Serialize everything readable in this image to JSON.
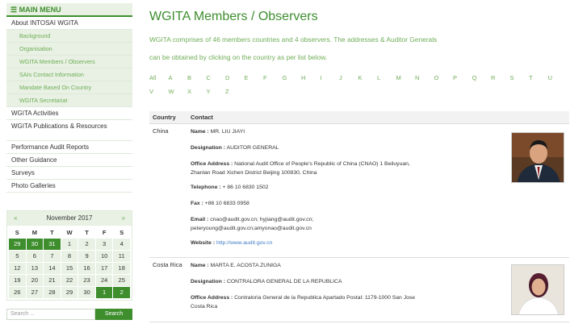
{
  "sidebar": {
    "menu_title": "MAIN MENU",
    "items": [
      {
        "label": "About INTOSAI WGITA",
        "sub": false
      },
      {
        "label": "Background",
        "sub": true
      },
      {
        "label": "Organisation",
        "sub": true
      },
      {
        "label": "WGITA Members / Observers",
        "sub": true
      },
      {
        "label": "SAIs Contact Information",
        "sub": true
      },
      {
        "label": "Mandate Based On Country",
        "sub": true
      },
      {
        "label": "WGITA Secretariat",
        "sub": true
      },
      {
        "label": "WGITA Activities",
        "sub": false
      },
      {
        "label": "WGITA Publications & Resources",
        "sub": false
      },
      {
        "label": "Performance Audit Reports",
        "sub": false
      },
      {
        "label": "Other Guidance",
        "sub": false
      },
      {
        "label": "Surveys",
        "sub": false
      },
      {
        "label": "Photo Galleries",
        "sub": false
      }
    ]
  },
  "calendar": {
    "month": "November 2017",
    "prev": "«",
    "next": "»",
    "dow": [
      "S",
      "M",
      "T",
      "W",
      "T",
      "F",
      "S"
    ],
    "days": [
      {
        "d": "29",
        "hl": true
      },
      {
        "d": "30",
        "hl": true
      },
      {
        "d": "31",
        "hl": true
      },
      {
        "d": "1",
        "hl": false
      },
      {
        "d": "2",
        "hl": false
      },
      {
        "d": "3",
        "hl": false
      },
      {
        "d": "4",
        "hl": false
      },
      {
        "d": "5",
        "hl": false
      },
      {
        "d": "6",
        "hl": false
      },
      {
        "d": "7",
        "hl": false
      },
      {
        "d": "8",
        "hl": false
      },
      {
        "d": "9",
        "hl": false
      },
      {
        "d": "10",
        "hl": false
      },
      {
        "d": "11",
        "hl": false
      },
      {
        "d": "12",
        "hl": false
      },
      {
        "d": "13",
        "hl": false
      },
      {
        "d": "14",
        "hl": false
      },
      {
        "d": "15",
        "hl": false
      },
      {
        "d": "16",
        "hl": false
      },
      {
        "d": "17",
        "hl": false
      },
      {
        "d": "18",
        "hl": false
      },
      {
        "d": "19",
        "hl": false
      },
      {
        "d": "20",
        "hl": false
      },
      {
        "d": "21",
        "hl": false
      },
      {
        "d": "22",
        "hl": false
      },
      {
        "d": "23",
        "hl": false
      },
      {
        "d": "24",
        "hl": false
      },
      {
        "d": "25",
        "hl": false
      },
      {
        "d": "26",
        "hl": false
      },
      {
        "d": "27",
        "hl": false
      },
      {
        "d": "28",
        "hl": false
      },
      {
        "d": "29",
        "hl": false
      },
      {
        "d": "30",
        "hl": false
      },
      {
        "d": "1",
        "hl": true
      },
      {
        "d": "2",
        "hl": true
      }
    ]
  },
  "search": {
    "placeholder": "Search ...",
    "button": "Search"
  },
  "main": {
    "title": "WGITA Members / Observers",
    "intro_line1": "WGITA comprises of 46 members countries and 4 observers. The addresses & Auditor Generals",
    "intro_line2": "can be obtained by clicking on the country as per list below.",
    "alphabet": [
      "All",
      "A",
      "B",
      "C",
      "D",
      "E",
      "F",
      "G",
      "H",
      "I",
      "J",
      "K",
      "L",
      "M",
      "N",
      "O",
      "P",
      "Q",
      "R",
      "S",
      "T",
      "U",
      "V",
      "W",
      "X",
      "Y",
      "Z"
    ],
    "table_headers": {
      "country": "Country",
      "contact": "Contact"
    },
    "rows": [
      {
        "country": "China",
        "name_label": "Name :",
        "name": "MR. LIU JIAYI",
        "designation_label": "Designation :",
        "designation": "AUDITOR GENERAL",
        "office_label": "Office Address :",
        "office_line1": "National Audit Office of People's Republic of China (CNAO) 1 Beiluyuan,",
        "office_line2": "Zhanlan Road Xichen District Beijing 100830, China",
        "telephone_label": "Telephone :",
        "telephone": "+ 86 10 6830 1502",
        "fax_label": "Fax :",
        "fax": "+86 10 6833 0958",
        "email_label": "Email :",
        "email_line1": "cnao@audit.gov.cn; hyjiang@audit.gov.cn;",
        "email_line2": "peteryoung@audit.gov.cn;amyonao@audit.gov.cn",
        "website_label": "Website :",
        "website": "http://www.audit.gov.cn"
      },
      {
        "country": "Costa Rica",
        "name_label": "Name :",
        "name": "MARTA E. ACOSTA ZUNIGA",
        "designation_label": "Designation :",
        "designation": "CONTRALORA GENERAL DE LA REPUBLICA",
        "office_label": "Office Address :",
        "office_line1": "Contraloria General de la Republica Apartado Postal: 1179-1000 San Jose",
        "office_line2": "Costa Rica"
      }
    ]
  },
  "colors": {
    "accent": "#3e8e2e",
    "accent_light": "#6fae58",
    "panel": "#e8f1e3",
    "link": "#3e7cc4"
  }
}
